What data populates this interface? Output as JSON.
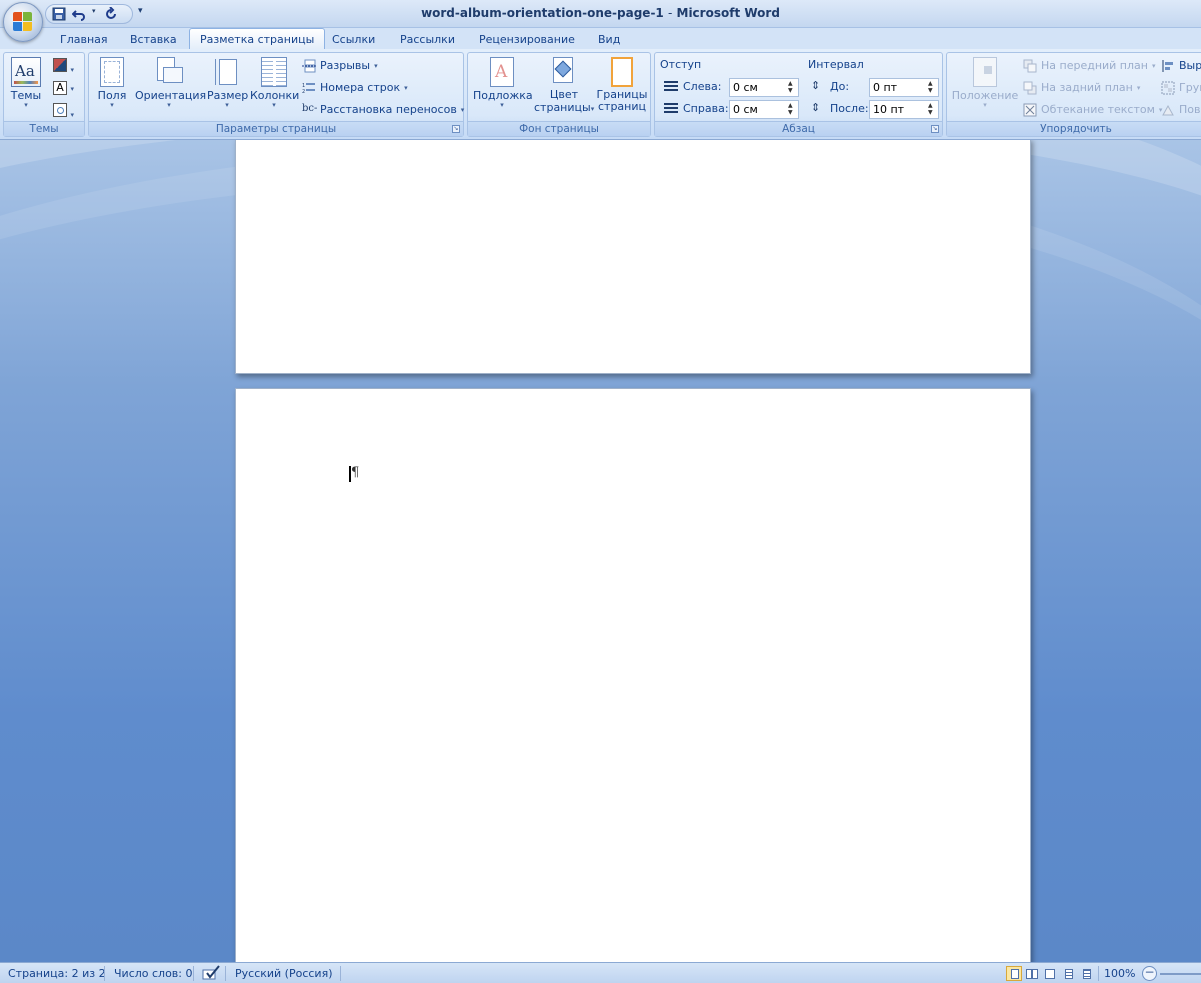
{
  "window": {
    "doc_name": "word-album-orientation-one-page-1",
    "separator": "-",
    "app_name": "Microsoft Word"
  },
  "qat": {
    "customize_glyph": "▾"
  },
  "tabs": [
    {
      "label": "Главная",
      "active": false
    },
    {
      "label": "Вставка",
      "active": false
    },
    {
      "label": "Разметка страницы",
      "active": true
    },
    {
      "label": "Ссылки",
      "active": false
    },
    {
      "label": "Рассылки",
      "active": false
    },
    {
      "label": "Рецензирование",
      "active": false
    },
    {
      "label": "Вид",
      "active": false
    }
  ],
  "ribbon": {
    "themes": {
      "label": "Темы",
      "button": "Темы"
    },
    "page_setup": {
      "label": "Параметры страницы",
      "margins": "Поля",
      "orientation": "Ориентация",
      "size": "Размер",
      "columns": "Колонки",
      "breaks": "Разрывы",
      "line_numbers": "Номера строк",
      "hyphenation": "Расстановка переносов"
    },
    "page_background": {
      "label": "Фон страницы",
      "watermark": "Подложка",
      "page_color_1": "Цвет",
      "page_color_2": "страницы",
      "borders_1": "Границы",
      "borders_2": "страниц"
    },
    "paragraph": {
      "label": "Абзац",
      "indent_title": "Отступ",
      "left_label": "Слева:",
      "left_value": "0 см",
      "right_label": "Справа:",
      "right_value": "0 см",
      "spacing_title": "Интервал",
      "before_label": "До:",
      "before_value": "0 пт",
      "after_label": "После:",
      "after_value": "10 пт"
    },
    "arrange": {
      "label": "Упорядочить",
      "position": "Положение",
      "bring_front": "На передний план",
      "send_back": "На задний план",
      "text_wrap": "Обтекание текстом",
      "align": "Выр",
      "group": "Груп",
      "rotate": "Пов"
    }
  },
  "document": {
    "paragraph_mark": "¶"
  },
  "statusbar": {
    "page": "Страница: 2 из 2",
    "words": "Число слов: 0",
    "language": "Русский (Россия)",
    "zoom": "100%"
  },
  "colors": {
    "ribbon_text": "#15428b",
    "workspace": "#5f8ccd",
    "active_view": "#fbe7a2"
  }
}
